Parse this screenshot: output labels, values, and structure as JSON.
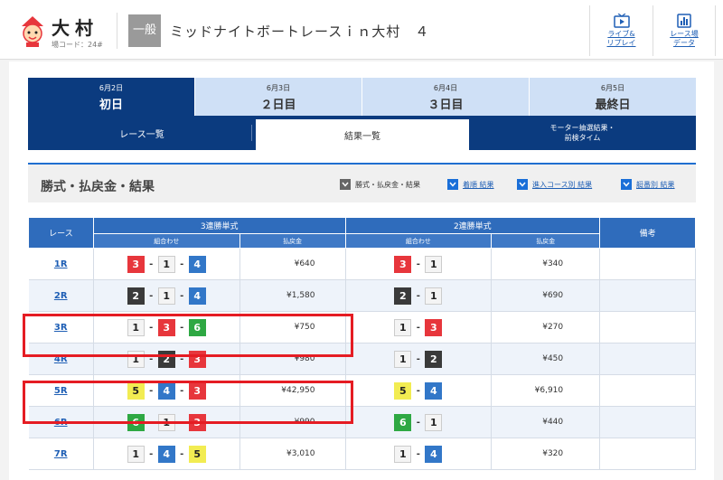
{
  "header": {
    "venue_name": "大村",
    "venue_code": "場コード：24#",
    "grade": "一般",
    "race_title": "ミッドナイトボートレースｉｎ大村　４",
    "live_label_1": "ライブ&",
    "live_label_2": "リプレイ",
    "data_label_1": "レース場",
    "data_label_2": "データ"
  },
  "day_tabs": [
    {
      "date": "6月2日",
      "label": "初日"
    },
    {
      "date": "6月3日",
      "label": "２日目"
    },
    {
      "date": "6月4日",
      "label": "３日目"
    },
    {
      "date": "6月5日",
      "label": "最終日"
    }
  ],
  "sub_tabs": {
    "race_list": "レース一覧",
    "results": "結果一覧",
    "motor_1": "モーター抽選結果・",
    "motor_2": "前検タイム"
  },
  "section": {
    "title": "勝式・払戻金・結果",
    "opt1": "勝式・払戻金・結果",
    "opt2": "着順 結果",
    "opt3": "進入コース別 結果",
    "opt4": "艇番別 結果"
  },
  "table": {
    "h_race": "レース",
    "h_trifecta": "3連勝単式",
    "h_exacta": "2連勝単式",
    "h_note": "備考",
    "h_combo": "組合わせ",
    "h_pay": "払戻金",
    "h_combo2": "組合わせ",
    "h_pay2": "払戻金",
    "rows": [
      {
        "race": "1R",
        "t1": "3",
        "t2": "1",
        "t3": "4",
        "tpay": "¥640",
        "e1": "3",
        "e2": "1",
        "epay": "¥340"
      },
      {
        "race": "2R",
        "t1": "2",
        "t2": "1",
        "t3": "4",
        "tpay": "¥1,580",
        "e1": "2",
        "e2": "1",
        "epay": "¥690"
      },
      {
        "race": "3R",
        "t1": "1",
        "t2": "3",
        "t3": "6",
        "tpay": "¥750",
        "e1": "1",
        "e2": "3",
        "epay": "¥270"
      },
      {
        "race": "4R",
        "t1": "1",
        "t2": "2",
        "t3": "3",
        "tpay": "¥980",
        "e1": "1",
        "e2": "2",
        "epay": "¥450"
      },
      {
        "race": "5R",
        "t1": "5",
        "t2": "4",
        "t3": "3",
        "tpay": "¥42,950",
        "e1": "5",
        "e2": "4",
        "epay": "¥6,910"
      },
      {
        "race": "6R",
        "t1": "6",
        "t2": "1",
        "t3": "3",
        "tpay": "¥990",
        "e1": "6",
        "e2": "1",
        "epay": "¥440"
      },
      {
        "race": "7R",
        "t1": "1",
        "t2": "4",
        "t3": "5",
        "tpay": "¥3,010",
        "e1": "1",
        "e2": "4",
        "epay": "¥320"
      }
    ]
  },
  "colors": {
    "navy": "#0b3b7f",
    "header_blue": "#2f6cbc",
    "highlight_red": "#e51c23",
    "boat_1": "#f4f4f4",
    "boat_2": "#3a3a3a",
    "boat_3": "#e7363c",
    "boat_4": "#3277c8",
    "boat_5": "#f2ec52",
    "boat_6": "#2ea843"
  }
}
